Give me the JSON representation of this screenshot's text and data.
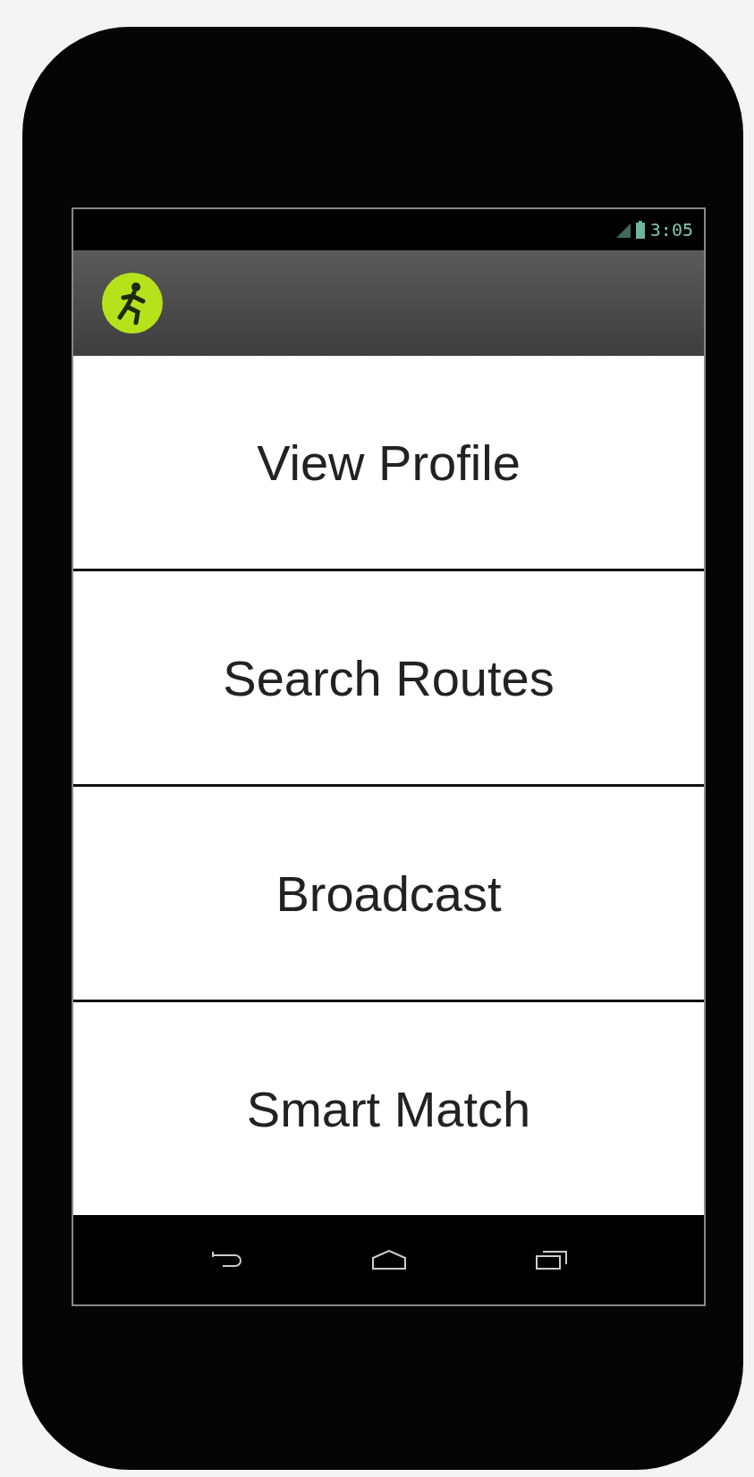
{
  "status_bar": {
    "time": "3:05"
  },
  "menu": [
    {
      "label": "View Profile"
    },
    {
      "label": "Search Routes"
    },
    {
      "label": "Broadcast"
    },
    {
      "label": "Smart Match"
    }
  ]
}
